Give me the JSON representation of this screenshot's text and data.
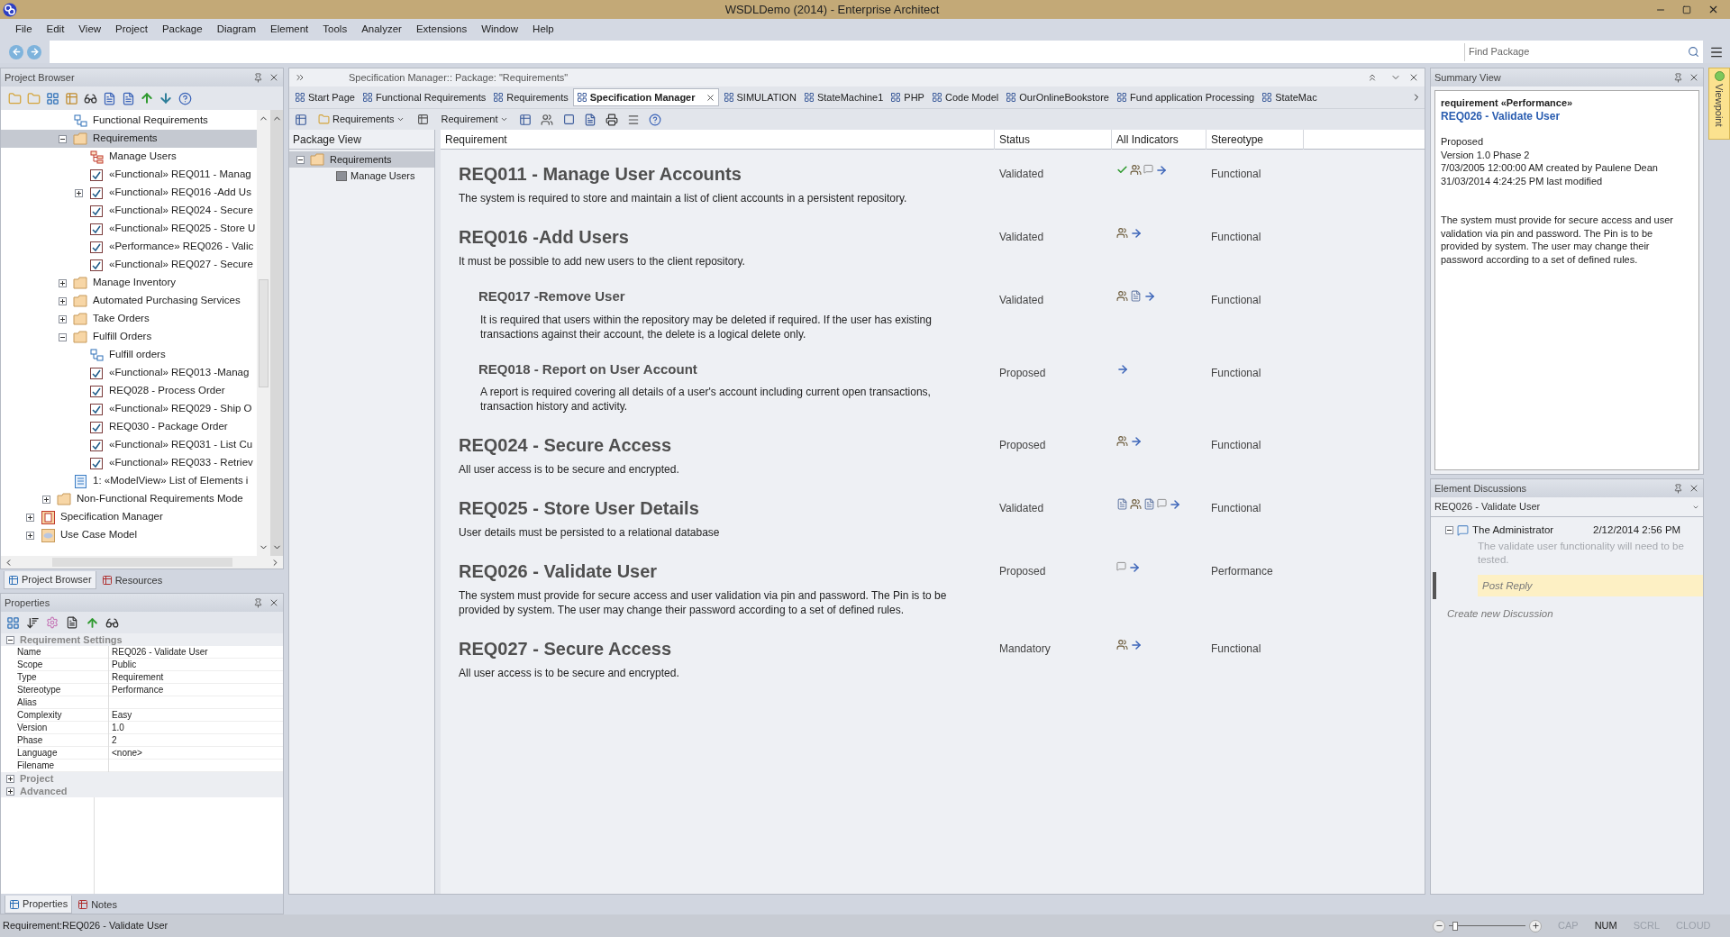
{
  "window": {
    "title": "WSDLDemo (2014) - Enterprise Architect"
  },
  "menu": [
    "File",
    "Edit",
    "View",
    "Project",
    "Package",
    "Diagram",
    "Element",
    "Tools",
    "Analyzer",
    "Extensions",
    "Window",
    "Help"
  ],
  "find_package": {
    "placeholder": "Find Package"
  },
  "project_browser": {
    "title": "Project Browser",
    "tree": [
      {
        "children": [
          {
            "children": [
              {
                "label": "Functional Requirements",
                "kind": "package-diagram",
                "selected": false
              },
              {
                "label": "Requirements",
                "kind": "folder",
                "selected": true,
                "expanded": true,
                "children": [
                  {
                    "label": "Manage Users",
                    "kind": "diagram",
                    "selected": false
                  },
                  {
                    "label": "«Functional» REQ011 - Manag",
                    "kind": "requirement",
                    "selected": false
                  },
                  {
                    "label": "«Functional» REQ016 -Add Us",
                    "kind": "requirement",
                    "selected": false,
                    "expanded": false
                  },
                  {
                    "label": "«Functional» REQ024 - Secure",
                    "kind": "requirement",
                    "selected": false
                  },
                  {
                    "label": "«Functional» REQ025 - Store U",
                    "kind": "requirement",
                    "selected": false
                  },
                  {
                    "label": "«Performance» REQ026 - Valic",
                    "kind": "requirement",
                    "selected": false
                  },
                  {
                    "label": "«Functional» REQ027 - Secure",
                    "kind": "requirement",
                    "selected": false
                  }
                ]
              },
              {
                "label": "Manage Inventory",
                "kind": "folder",
                "selected": false,
                "expanded": false
              },
              {
                "label": "Automated Purchasing Services",
                "kind": "folder",
                "selected": false,
                "expanded": false
              },
              {
                "label": "Take Orders",
                "kind": "folder",
                "selected": false,
                "expanded": false
              },
              {
                "label": "Fulfill Orders",
                "kind": "folder",
                "selected": false,
                "expanded": true,
                "children": [
                  {
                    "label": "Fulfill orders",
                    "kind": "package-diagram",
                    "selected": false
                  },
                  {
                    "label": "«Functional» REQ013 -Manag",
                    "kind": "requirement",
                    "selected": false
                  },
                  {
                    "label": "REQ028 - Process Order",
                    "kind": "requirement",
                    "selected": false
                  },
                  {
                    "label": "«Functional» REQ029 - Ship O",
                    "kind": "requirement",
                    "selected": false
                  },
                  {
                    "label": "REQ030 - Package Order",
                    "kind": "requirement",
                    "selected": false
                  },
                  {
                    "label": "«Functional» REQ031 - List Cu",
                    "kind": "requirement",
                    "selected": false
                  },
                  {
                    "label": "«Functional» REQ033 - Retriev",
                    "kind": "requirement",
                    "selected": false
                  }
                ]
              },
              {
                "label": "1: «ModelView» List of Elements i",
                "kind": "modelview",
                "selected": false
              }
            ]
          },
          {
            "label": "Non-Functional Requirements Mode",
            "kind": "folder",
            "selected": false,
            "expanded": false
          }
        ]
      },
      {
        "label": "Specification Manager",
        "kind": "spec",
        "selected": false,
        "expanded": false
      },
      {
        "label": "Use Case Model",
        "kind": "usecase",
        "selected": false,
        "expanded": false
      }
    ]
  },
  "left_tabs": [
    {
      "label": "Project Browser",
      "selected": true
    },
    {
      "label": "Resources",
      "selected": false
    }
  ],
  "properties": {
    "title": "Properties",
    "sections": [
      {
        "title": "Requirement Settings",
        "expanded": true,
        "rows": [
          {
            "name": "Name",
            "value": "REQ026 - Validate User"
          },
          {
            "name": "Scope",
            "value": "Public"
          },
          {
            "name": "Type",
            "value": "Requirement"
          },
          {
            "name": "Stereotype",
            "value": "Performance"
          },
          {
            "name": "Alias"
          },
          {
            "name": "Complexity",
            "value": "Easy"
          },
          {
            "name": "Version",
            "value": "1.0"
          },
          {
            "name": "Phase",
            "value": "2"
          },
          {
            "name": "Language",
            "value": "<none>"
          },
          {
            "name": "Filename"
          }
        ]
      },
      {
        "title": "Project",
        "expanded": false
      },
      {
        "title": "Advanced",
        "expanded": false
      }
    ]
  },
  "properties_tabs": [
    {
      "label": "Properties",
      "selected": true
    },
    {
      "label": "Notes",
      "selected": false
    }
  ],
  "center": {
    "header": "Specification Manager::  Package: \"Requirements\"",
    "tabs": [
      {
        "label": "Start Page",
        "selected": false
      },
      {
        "label": "Functional Requirements",
        "selected": false
      },
      {
        "label": "Requirements",
        "selected": false
      },
      {
        "label": "Specification Manager",
        "selected": true
      },
      {
        "label": "SIMULATION",
        "selected": false
      },
      {
        "label": "StateMachine1",
        "selected": false
      },
      {
        "label": "PHP",
        "selected": false
      },
      {
        "label": "Code Model",
        "selected": false
      },
      {
        "label": "OurOnlineBookstore",
        "selected": false
      },
      {
        "label": "Fund application Processing",
        "selected": false
      },
      {
        "label": "StateMac",
        "selected": false
      }
    ],
    "toolbar": {
      "package_dropdown": "Requirements",
      "type_dropdown": "Requirement"
    },
    "package_view": {
      "title": "Package View",
      "tree": [
        {
          "label": "Requirements",
          "selected": true,
          "expanded": true,
          "children": [
            {
              "label": "Manage Users",
              "selected": false
            }
          ]
        }
      ]
    },
    "columns": [
      "Requirement",
      "Status",
      "All Indicators",
      "Stereotype"
    ],
    "requirements": [
      {
        "title": "REQ011 - Manage User Accounts",
        "status": "Validated",
        "indicators": [
          {
            "kind": "check"
          },
          {
            "kind": "actor"
          },
          {
            "kind": "comment"
          },
          {
            "kind": "arrow"
          }
        ],
        "stereotype": "Functional",
        "description": "The system is required to store and maintain a list of client accounts in a persistent repository."
      },
      {
        "title": "REQ016 -Add Users",
        "status": "Validated",
        "indicators": [
          {
            "kind": "actor"
          },
          {
            "kind": "arrow"
          }
        ],
        "stereotype": "Functional",
        "description": "It must be possible to add new users to the client repository.",
        "children": [
          {
            "title": "REQ017 -Remove User",
            "status": "Validated",
            "indicators": [
              {
                "kind": "actor"
              },
              {
                "kind": "doc"
              },
              {
                "kind": "arrow"
              }
            ],
            "stereotype": "Functional",
            "description": "It is required that users within the repository may be deleted if required. If the user has existing transactions against their account, the delete is a logical delete only."
          },
          {
            "title": "REQ018 - Report on User Account",
            "status": "Proposed",
            "indicators": [
              {
                "kind": "arrow"
              }
            ],
            "stereotype": "Functional",
            "description": "A report is required covering all details of a user's account including current open transactions, transaction history and activity."
          }
        ]
      },
      {
        "title": "REQ024 - Secure Access",
        "status": "Proposed",
        "indicators": [
          {
            "kind": "actor"
          },
          {
            "kind": "arrow"
          }
        ],
        "stereotype": "Functional",
        "description": "All user access is to be secure and encrypted."
      },
      {
        "title": "REQ025 - Store User Details",
        "status": "Validated",
        "indicators": [
          {
            "kind": "doc"
          },
          {
            "kind": "actor"
          },
          {
            "kind": "doc"
          },
          {
            "kind": "comment"
          },
          {
            "kind": "arrow"
          }
        ],
        "stereotype": "Functional",
        "description": "User details must be persisted to a relational database"
      },
      {
        "title": "REQ026 - Validate User",
        "status": "Proposed",
        "indicators": [
          {
            "kind": "comment"
          },
          {
            "kind": "arrow"
          }
        ],
        "stereotype": "Performance",
        "description": "The system must provide for secure access and user validation via pin and password. The Pin is to be provided by system. The user may change their password according to a set of defined rules."
      },
      {
        "title": "REQ027 - Secure Access",
        "status": "Mandatory",
        "indicators": [
          {
            "kind": "actor"
          },
          {
            "kind": "arrow"
          }
        ],
        "stereotype": "Functional",
        "description": "All user access is to be secure and encrypted."
      }
    ]
  },
  "summary": {
    "title": "Summary View",
    "type_line": "requirement  «Performance»",
    "name": "REQ026 - Validate User",
    "lines": [
      "Proposed",
      "Version 1.0  Phase 2",
      "7/03/2005 12:00:00 AM created by Paulene Dean",
      "31/03/2014 4:24:25 PM last modified"
    ],
    "notes": "The system must provide for secure access and user validation via pin and password. The Pin is to be provided by system. The user may change their password according to a set of defined rules."
  },
  "discussions": {
    "title": "Element Discussions",
    "element": "REQ026 - Validate User",
    "items": [
      {
        "author": "The Administrator",
        "date": "2/12/2014 2:56 PM",
        "text": "The validate user functionality will need to be tested.",
        "expanded": true
      }
    ],
    "reply": {
      "placeholder": "Post Reply"
    },
    "create_link": "Create new Discussion"
  },
  "viewpoint_tab": "Viewpoint",
  "status_bar": {
    "text": "Requirement:REQ026 - Validate User",
    "zoom": {
      "level": 0.05
    },
    "indicators": [
      {
        "label": "CAP",
        "on": false
      },
      {
        "label": "NUM",
        "on": true
      },
      {
        "label": "SCRL",
        "on": false
      },
      {
        "label": "CLOUD",
        "on": false
      }
    ]
  }
}
